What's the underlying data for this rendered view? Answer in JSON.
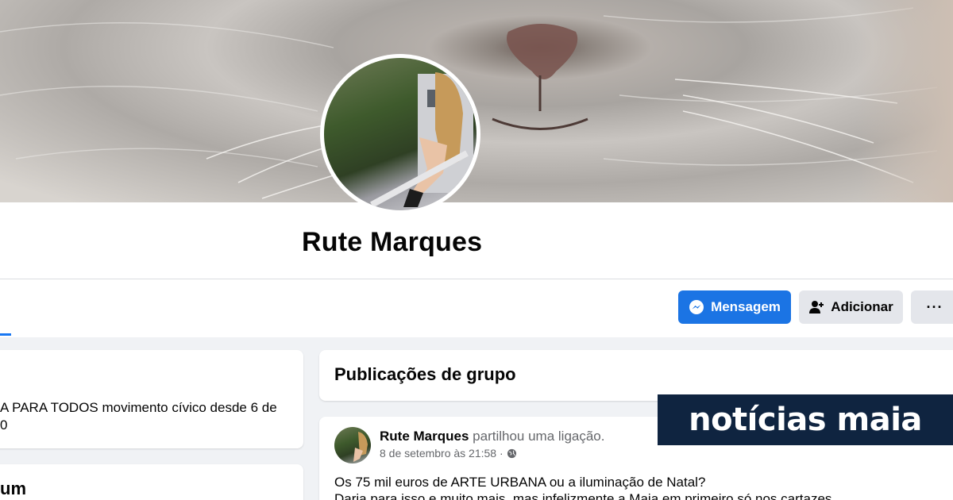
{
  "profile": {
    "name": "Rute Marques"
  },
  "actions": {
    "message_label": "Mensagem",
    "add_label": "Adicionar",
    "more_label": "···"
  },
  "intro": {
    "text_line1": "A PARA TODOS movimento cívico desde 6 de",
    "text_line2": "0"
  },
  "album": {
    "title_fragment": "um"
  },
  "group_posts": {
    "title": "Publicações de grupo",
    "post": {
      "author": "Rute Marques",
      "action": "partilhou uma ligação.",
      "date": "8 de setembro às 21:58 ·",
      "line1": "Os 75 mil euros de ARTE URBANA ou a iluminação de Natal?",
      "line2": "Daria para isso e muito mais, mas infelizmente a Maia em primeiro só nos cartazes"
    }
  },
  "watermark": {
    "text": "notícias maia"
  },
  "icons": {
    "messenger": "messenger-icon",
    "add_friend": "add-friend-icon",
    "globe": "globe-icon"
  },
  "colors": {
    "primary": "#1b74e4",
    "secondary_button": "#e4e6eb",
    "page_bg": "#f0f2f5",
    "brand_bg": "#0f2440"
  }
}
